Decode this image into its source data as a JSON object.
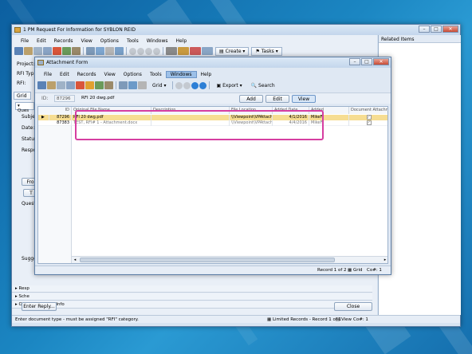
{
  "main_window": {
    "title": "1 PM Request For Information for SYBLON REID",
    "menu": [
      "File",
      "Edit",
      "Records",
      "View",
      "Options",
      "Tools",
      "Windows",
      "Help"
    ],
    "toolbar_create": "Create",
    "toolbar_tasks": "Tasks",
    "left_labels": [
      "Project:",
      "RFI Typ",
      "RFI:"
    ],
    "tab_grid": "Grid",
    "tab_question": "Ques",
    "fields": [
      "Subje",
      "Date:",
      "Status",
      "Respo",
      "Questi",
      "Sugge"
    ],
    "small_btns": [
      "Fro",
      "T"
    ],
    "sections": [
      "Resp",
      "Sche",
      "Other Reference Info"
    ],
    "enter_reply": "Enter Reply...",
    "close": "Close",
    "status_left": "Enter document type - must be assigned \"RFI\" category.",
    "status_right": [
      "Limited Records - Record 1 of 1",
      "View",
      "Co#: 1"
    ],
    "related_items": "Related Items"
  },
  "attach_window": {
    "title": "Attachment Form",
    "menu": [
      "File",
      "Edit",
      "Records",
      "View",
      "Options",
      "Tools",
      "Windows",
      "Help"
    ],
    "active_menu": "Windows",
    "toolbar_grid": "Grid",
    "toolbar_export": "Export",
    "toolbar_search": "Search",
    "id_label": "ID:",
    "id_value": "87296",
    "file_value": "RFI 20 dwg.pdf",
    "add": "Add",
    "edit": "Edit",
    "view": "View",
    "columns": [
      "ID",
      "Original File Name",
      "Description",
      "File Location",
      "Added Date",
      "Added",
      "Document Attachme"
    ],
    "rows": [
      {
        "id": "87296",
        "name": "RFI 20 dwg.pdf",
        "desc": "",
        "loc": "\\\\Viewpoint\\VPAttachr",
        "date": "4/1/2016",
        "by": "MikeF",
        "doc": "✓"
      },
      {
        "id": "87383",
        "name": "TEST, RFI# 1 - Attachment.docx",
        "desc": "",
        "loc": "\\\\Viewpoint\\VPAttachr",
        "date": "4/4/2016",
        "by": "MikeF",
        "doc": "✓"
      }
    ],
    "status_record": "Record 1 of 2",
    "status_grid": "Grid",
    "status_co": "Co#: 1"
  },
  "colors": {
    "highlight": "#d63ea1",
    "row_selected": "#f6dd92"
  }
}
